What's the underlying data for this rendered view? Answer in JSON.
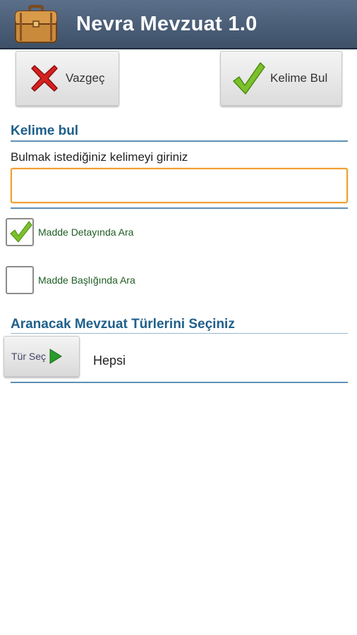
{
  "app": {
    "title": "Nevra Mevzuat 1.0",
    "icon": "briefcase-icon"
  },
  "toolbar": {
    "cancel_label": "Vazgeç",
    "cancel_icon": "red-x-icon",
    "find_label": "Kelime Bul",
    "find_icon": "green-check-icon"
  },
  "search": {
    "section_title": "Kelime bul",
    "prompt": "Bulmak istediğiniz kelimeyi giriniz",
    "value": "",
    "placeholder": ""
  },
  "options": [
    {
      "label": "Madde Detayında Ara",
      "checked": true
    },
    {
      "label": "Madde Başlığında Ara",
      "checked": false
    }
  ],
  "types": {
    "section_title": "Aranacak Mevzuat Türlerini Seçiniz",
    "button_label": "Tür Seç",
    "button_icon": "play-arrow-icon",
    "selected": "Hepsi"
  },
  "colors": {
    "titlebar": "#4a5d78",
    "section_title": "#1f5f8b",
    "input_focus": "#f0a030",
    "check_green": "#7cc02a",
    "option_label": "#1d5d22"
  }
}
